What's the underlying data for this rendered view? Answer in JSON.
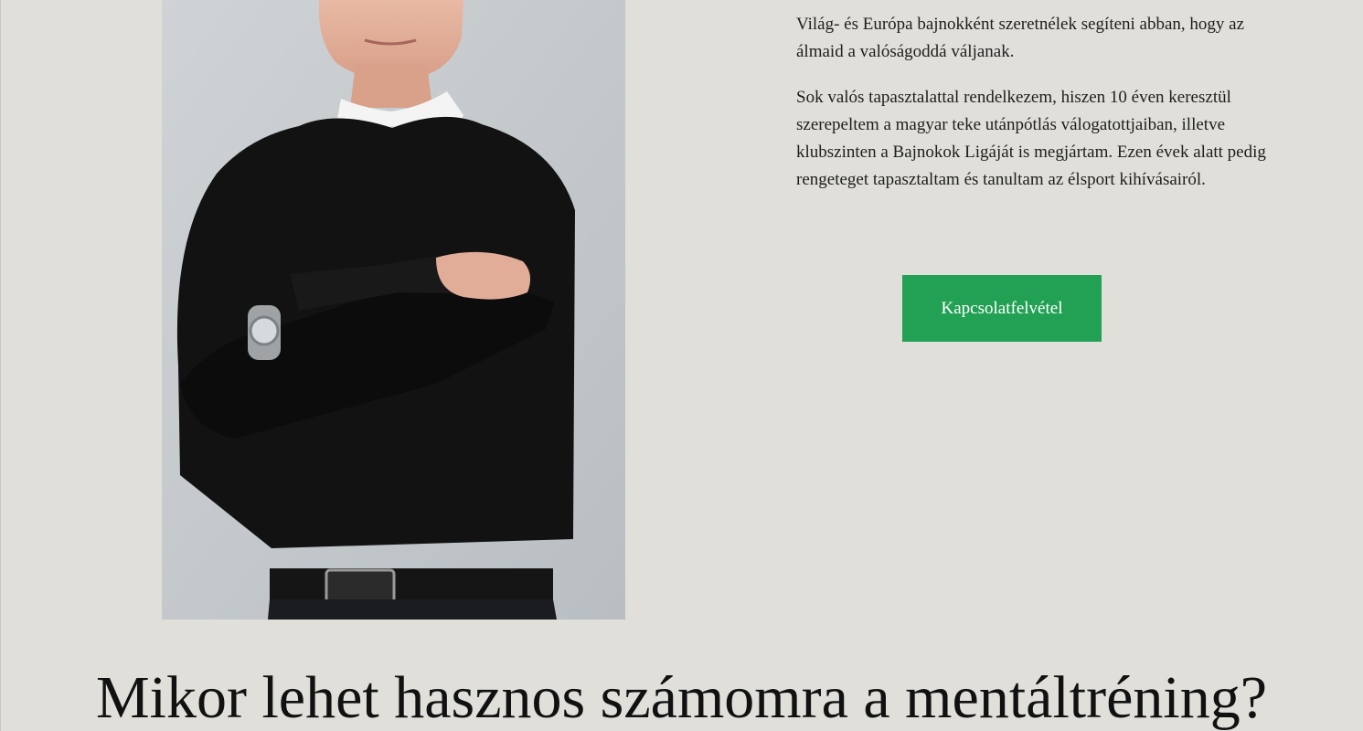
{
  "about": {
    "paragraph_1": "Világ- és Európa bajnokként szeretnélek segíteni abban, hogy az álmaid a valóságoddá váljanak.",
    "paragraph_2": "Sok valós tapasztalattal rendelkezem, hiszen 10 éven keresztül szerepeltem a magyar teke utánpótlás válogatottjaiban, illetve klubszinten a Bajnokok Ligáját is megjártam. Ezen évek alatt pedig rengeteget tapasztaltam és tanultam az élsport kihívásairól.",
    "cta_label": "Kapcsolatfelvétel"
  },
  "section": {
    "heading": "Mikor lehet hasznos számomra a mentáltréning?"
  },
  "colors": {
    "background": "#e0dfd9",
    "cta_background": "#22a155",
    "cta_text": "#ffffff"
  }
}
